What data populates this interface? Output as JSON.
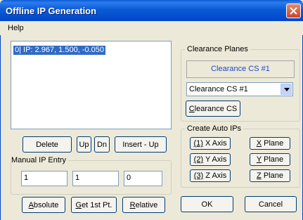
{
  "window": {
    "title": "Offline IP Generation"
  },
  "menu": {
    "help": "Help"
  },
  "ip_list": {
    "items": [
      "0| IP: 2.967, 1.500, -0.050"
    ]
  },
  "list_buttons": {
    "delete": "Delete",
    "up": "Up",
    "dn": "Dn",
    "insert_up": "Insert - Up"
  },
  "manual_entry": {
    "label": "Manual IP Entry",
    "x_value": "1",
    "y_value": "1",
    "z_value": "0",
    "absolute_pre": "",
    "absolute_ul": "A",
    "absolute_post": "bsolute",
    "get_first_pre": "",
    "get_first_ul": "G",
    "get_first_post": "et 1st Pt.",
    "relative_pre": "",
    "relative_ul": "R",
    "relative_post": "elative"
  },
  "clearance_planes": {
    "label": "Clearance Planes",
    "display": "Clearance CS #1",
    "selected": "Clearance CS #1",
    "button_ul": "C",
    "button_post": "learance CS"
  },
  "auto_ips": {
    "label": "Create Auto IPs",
    "x_axis_ul": "(1)",
    "x_axis_post": " X Axis",
    "y_axis_ul": "(2)",
    "y_axis_post": " Y Axis",
    "z_axis_ul": "(3)",
    "z_axis_post": " Z Axis",
    "x_plane_ul": "X",
    "x_plane_post": " Plane",
    "y_plane_ul": "Y",
    "y_plane_post": " Plane",
    "z_plane_ul": "Z",
    "z_plane_post": " Plane"
  },
  "dialog_buttons": {
    "ok": "OK",
    "cancel": "Cancel"
  },
  "colors": {
    "title_bar": "#0a5bd6",
    "selection": "#316ac5",
    "cs_text": "#2147c8"
  }
}
